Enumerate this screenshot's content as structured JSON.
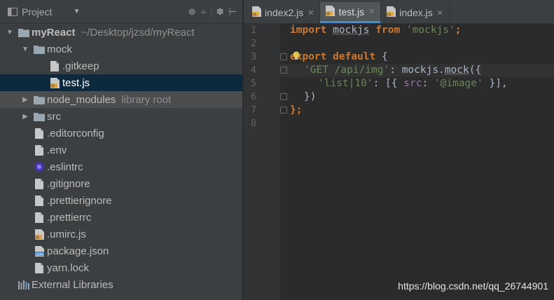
{
  "project": {
    "title": "Project",
    "dropdown": "▼",
    "toolbar": {
      "target": "⊕",
      "collapse": "÷",
      "settings": "✽",
      "hide": "⊢"
    },
    "tree": [
      {
        "label": "myReact",
        "hint": "~/Desktop/jzsd/myReact",
        "icon": "folder-icon",
        "arrow": "▼",
        "indent": 0,
        "bold": true
      },
      {
        "label": "mock",
        "hint": "",
        "icon": "folder-icon",
        "arrow": "▼",
        "indent": 1
      },
      {
        "label": ".gitkeep",
        "hint": "",
        "icon": "file-icon",
        "arrow": "",
        "indent": 2
      },
      {
        "label": "test.js",
        "hint": "",
        "icon": "js-file-icon",
        "arrow": "",
        "indent": 2,
        "selected": true
      },
      {
        "label": "node_modules",
        "hint": "library root",
        "icon": "folder-icon",
        "arrow": "▶",
        "indent": 1,
        "highlight": true
      },
      {
        "label": "src",
        "hint": "",
        "icon": "folder-icon",
        "arrow": "▶",
        "indent": 1
      },
      {
        "label": ".editorconfig",
        "hint": "",
        "icon": "file-icon",
        "arrow": "",
        "indent": 1
      },
      {
        "label": ".env",
        "hint": "",
        "icon": "file-icon",
        "arrow": "",
        "indent": 1
      },
      {
        "label": ".eslintrc",
        "hint": "",
        "icon": "eslint-icon",
        "arrow": "",
        "indent": 1
      },
      {
        "label": ".gitignore",
        "hint": "",
        "icon": "file-icon",
        "arrow": "",
        "indent": 1
      },
      {
        "label": ".prettierignore",
        "hint": "",
        "icon": "file-icon",
        "arrow": "",
        "indent": 1
      },
      {
        "label": ".prettierrc",
        "hint": "",
        "icon": "file-icon",
        "arrow": "",
        "indent": 1
      },
      {
        "label": ".umirc.js",
        "hint": "",
        "icon": "js-file-icon",
        "arrow": "",
        "indent": 1
      },
      {
        "label": "package.json",
        "hint": "",
        "icon": "json-file-icon",
        "arrow": "",
        "indent": 1
      },
      {
        "label": "yarn.lock",
        "hint": "",
        "icon": "file-icon",
        "arrow": "",
        "indent": 1
      },
      {
        "label": "External Libraries",
        "hint": "",
        "icon": "libraries-icon",
        "arrow": "",
        "indent": 0
      }
    ]
  },
  "editor": {
    "tabs": [
      {
        "label": "index2.js",
        "active": false
      },
      {
        "label": "test.js",
        "active": true
      },
      {
        "label": "index.js",
        "active": false
      }
    ],
    "line_numbers": [
      "1",
      "2",
      "3",
      "4",
      "5",
      "6",
      "7",
      "8"
    ],
    "code": {
      "l1": {
        "import": "import",
        "name": "mockjs",
        "from": "from",
        "source": "'mockjs'",
        "semi": ";"
      },
      "l3": {
        "export": "export",
        "default": "default",
        "brace": "{"
      },
      "l4": {
        "key": "'GET /api/img'",
        "colon": ": ",
        "obj": "mockjs",
        "dot": ".",
        "fn": "mock",
        "open": "({"
      },
      "l5": {
        "key": "'list|10'",
        "colon": ": [{ ",
        "prop": "src",
        "colon2": ": ",
        "val": "'@image'",
        "close": " }],"
      },
      "l6": {
        "close": "})"
      },
      "l7": {
        "close": "};"
      }
    }
  },
  "watermark": "https://blog.csdn.net/qq_26744901",
  "colors": {
    "selection": "#0d293e",
    "active_tab_underline": "#4a88c7",
    "keyword": "#cc7832",
    "string": "#6a8759"
  }
}
